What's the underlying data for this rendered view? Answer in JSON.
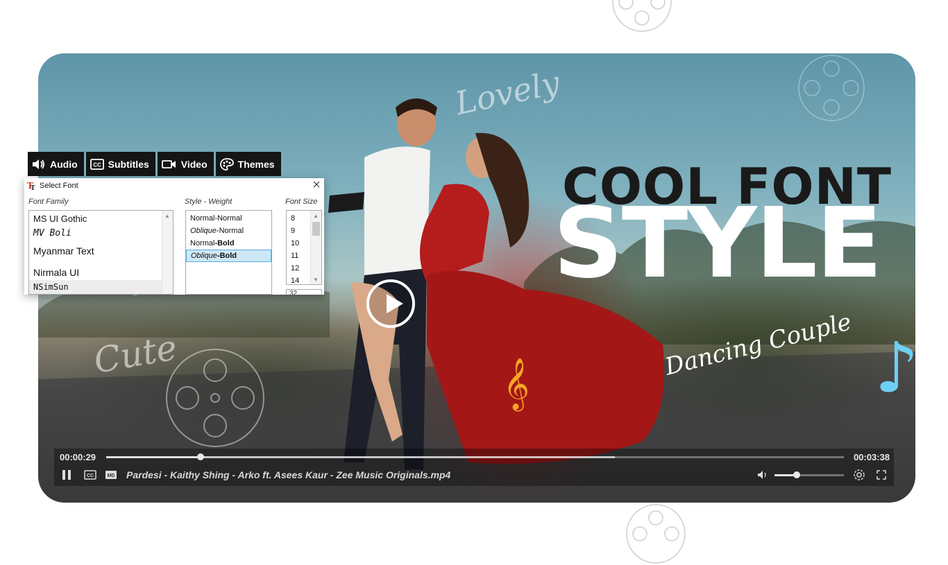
{
  "hero": {
    "title_line1": "COOL FONT",
    "title_line2": "STYLE",
    "script_lovely": "Lovely",
    "script_cute": "Cute",
    "script_dancing": "Dancing Couple"
  },
  "tabs": [
    {
      "label": "Audio",
      "icon": "speaker-icon"
    },
    {
      "label": "Subtitles",
      "icon": "cc-icon"
    },
    {
      "label": "Video",
      "icon": "camera-icon"
    },
    {
      "label": "Themes",
      "icon": "palette-icon"
    }
  ],
  "font_dialog": {
    "title": "Select Font",
    "family_label": "Font Family",
    "style_label": "Style - Weight",
    "size_label": "Font Size",
    "families": [
      "MS UI Gothic",
      "MV Boli",
      "Myanmar Text",
      "Nirmala UI",
      "NSimSun"
    ],
    "styles": [
      {
        "a": "Normal",
        "b": "-Normal"
      },
      {
        "a": "Oblique",
        "b": "-Normal"
      },
      {
        "a": "Normal",
        "b": "-Bold"
      },
      {
        "a": "Oblique",
        "b": "-Bold"
      }
    ],
    "selected_style": "Oblique-Bold",
    "sizes": [
      "8",
      "9",
      "10",
      "11",
      "12",
      "14"
    ],
    "size_input": "32"
  },
  "player": {
    "current_time": "00:00:29",
    "total_time": "00:03:38",
    "progress_fraction": 0.128,
    "buffered_fraction": 0.69,
    "volume_fraction": 0.32,
    "filename": "Pardesi - Kaithy Shing  - Arko ft. Asees Kaur - Zee Music Originals.mp4"
  },
  "colors": {
    "clef": "#f5a623",
    "note": "#6ecff5",
    "tab_bg": "#151515",
    "selection": "#cde8f7"
  }
}
